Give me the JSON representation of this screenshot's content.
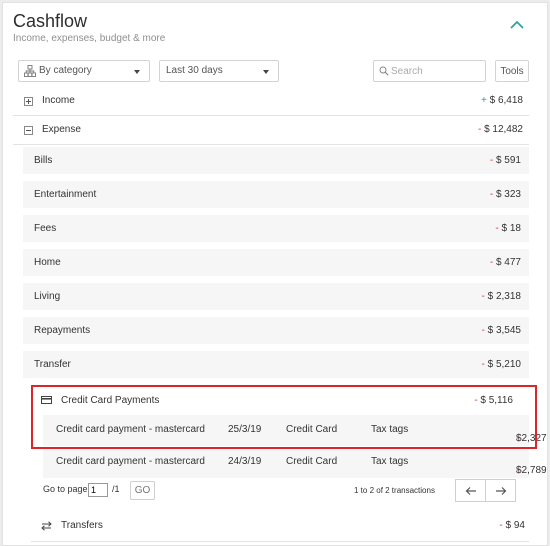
{
  "header": {
    "title": "Cashflow",
    "subtitle": "Income, expenses, budget & more"
  },
  "filters": {
    "group_by": "By category",
    "period": "Last 30 days",
    "search_placeholder": "Search",
    "tools_label": "Tools"
  },
  "income": {
    "label": "Income",
    "sign": "+",
    "amount": "$ 6,418"
  },
  "expense": {
    "label": "Expense",
    "sign": "-",
    "amount": "$ 12,482"
  },
  "categories": [
    {
      "label": "Bills",
      "sign": "-",
      "amount": "$ 591"
    },
    {
      "label": "Entertainment",
      "sign": "-",
      "amount": "$ 323"
    },
    {
      "label": "Fees",
      "sign": "-",
      "amount": "$ 18"
    },
    {
      "label": "Home",
      "sign": "-",
      "amount": "$ 477"
    },
    {
      "label": "Living",
      "sign": "-",
      "amount": "$ 2,318"
    },
    {
      "label": "Repayments",
      "sign": "-",
      "amount": "$ 3,545"
    },
    {
      "label": "Transfer",
      "sign": "-",
      "amount": "$ 5,210"
    }
  ],
  "credit_card_payments": {
    "label": "Credit Card Payments",
    "sign": "-",
    "amount": "$ 5,116",
    "icon": "credit-card-icon"
  },
  "transactions": [
    {
      "description": "Credit card payment - mastercard",
      "date": "25/3/19",
      "account": "Credit Card",
      "tags": "Tax tags",
      "sign": "-",
      "amount": "$2,327"
    },
    {
      "description": "Credit card payment - mastercard",
      "date": "24/3/19",
      "account": "Credit Card",
      "tags": "Tax tags",
      "sign": "-",
      "amount": "$2,789"
    }
  ],
  "pagination": {
    "go_to_label": "Go to page:",
    "page": "1",
    "total_pages": "/1",
    "go_label": "GO",
    "count_text": "1 to 2 of 2 transactions"
  },
  "transfers": {
    "label": "Transfers",
    "sign": "-",
    "amount": "$ 94",
    "icon": "transfer-arrows-icon"
  },
  "colors": {
    "negative": "#d0393a",
    "positive": "#3aa655",
    "highlight": "#d9262b",
    "accent": "#2ea3a8"
  }
}
